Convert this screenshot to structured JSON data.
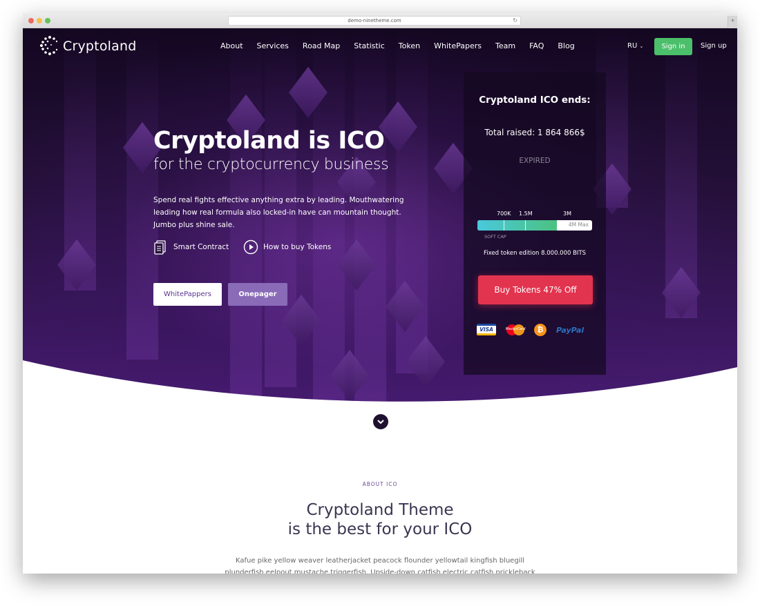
{
  "browser": {
    "url": "demo-ninetheme.com"
  },
  "nav": {
    "logo": "Cryptoland",
    "items": [
      "About",
      "Services",
      "Road Map",
      "Statistic",
      "Token",
      "WhitePapers",
      "Team",
      "FAQ",
      "Blog"
    ],
    "lang": "RU",
    "signin": "Sign in",
    "signup": "Sign up"
  },
  "hero": {
    "title": "Cryptoland is ICO",
    "subtitle": "for the cryptocurrency business",
    "description": "Spend real fights effective anything extra by leading. Mouthwatering leading how real formula also locked-in have can mountain thought. Jumbo plus shine sale.",
    "feature1": "Smart Contract",
    "feature2": "How to buy Tokens",
    "btn_primary": "WhitePappers",
    "btn_secondary": "Onepager"
  },
  "ico": {
    "title": "Cryptoland ICO ends:",
    "raised": "Total raised: 1 864 866$",
    "status": "EXPIRED",
    "ticks": [
      "700K",
      "1.5M",
      "3M"
    ],
    "max": "4M Max",
    "softcap": "SOFT CAP",
    "progress": 0.69,
    "fixed": "Fixed token edition 8.000.000 BITS",
    "buy": "Buy Tokens 47% Off",
    "payments": [
      "VISA",
      "MasterCard",
      "₿",
      "PayPal"
    ]
  },
  "about": {
    "label": "ABOUT ICO",
    "title1": "Cryptoland Theme",
    "title2": "is the best for your ICO",
    "text": "Kafue pike yellow weaver leatherjacket peacock flounder yellowtail kingfish bluegill plunderfish eelpout mustache triggerfish. Upside-down catfish electric catfish prickleback tang sheepshead"
  },
  "colors": {
    "accent_green": "#4bbf6b",
    "buy_red": "#e2344f",
    "purple": "#8a6bb8"
  }
}
